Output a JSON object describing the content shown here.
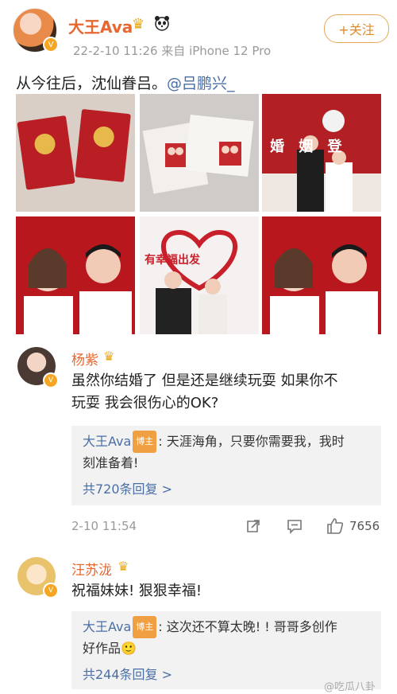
{
  "post": {
    "author": "大王Ava",
    "meta": "22-2-10 11:26 来自 iPhone 12 Pro",
    "follow_label": "+关注",
    "text": "从今往后，沈仙眷吕。",
    "mention": "@吕鹏兴_",
    "images": {
      "img3_text": "婚 姻 登",
      "img5_title": "有幸福出发"
    }
  },
  "comments": [
    {
      "name": "杨紫",
      "text_line1": "虽然你结婚了 但是还是继续玩耍 如果你不",
      "text_line2": "玩耍 我会很伤心的OK?",
      "reply": {
        "author": "大王Ava",
        "tag": "博主",
        "text_line1": ": 天涯海角，只要你需要我，我时",
        "text_line2": "刻准备着!",
        "count": "共720条回复 >"
      },
      "time": "2-10 11:54",
      "likes": "7656"
    },
    {
      "name": "汪苏泷",
      "text": "祝福妹妹! 狠狠幸福!",
      "reply": {
        "author": "大王Ava",
        "tag": "博主",
        "text_line1": ": 这次还不算太晚! ! 哥哥多创作",
        "text_line2": "好作品🙂",
        "count": "共244条回复 >"
      }
    }
  ],
  "watermark": "@吃瓜八卦",
  "icons": {
    "verify": "verified-badge-icon",
    "crown": "crown-icon",
    "share": "share-icon",
    "comment": "comment-icon",
    "like": "like-icon"
  },
  "colors": {
    "name_orange": "#e8662f",
    "link_blue": "#4a6fa5",
    "tag_orange": "#f0a042"
  }
}
